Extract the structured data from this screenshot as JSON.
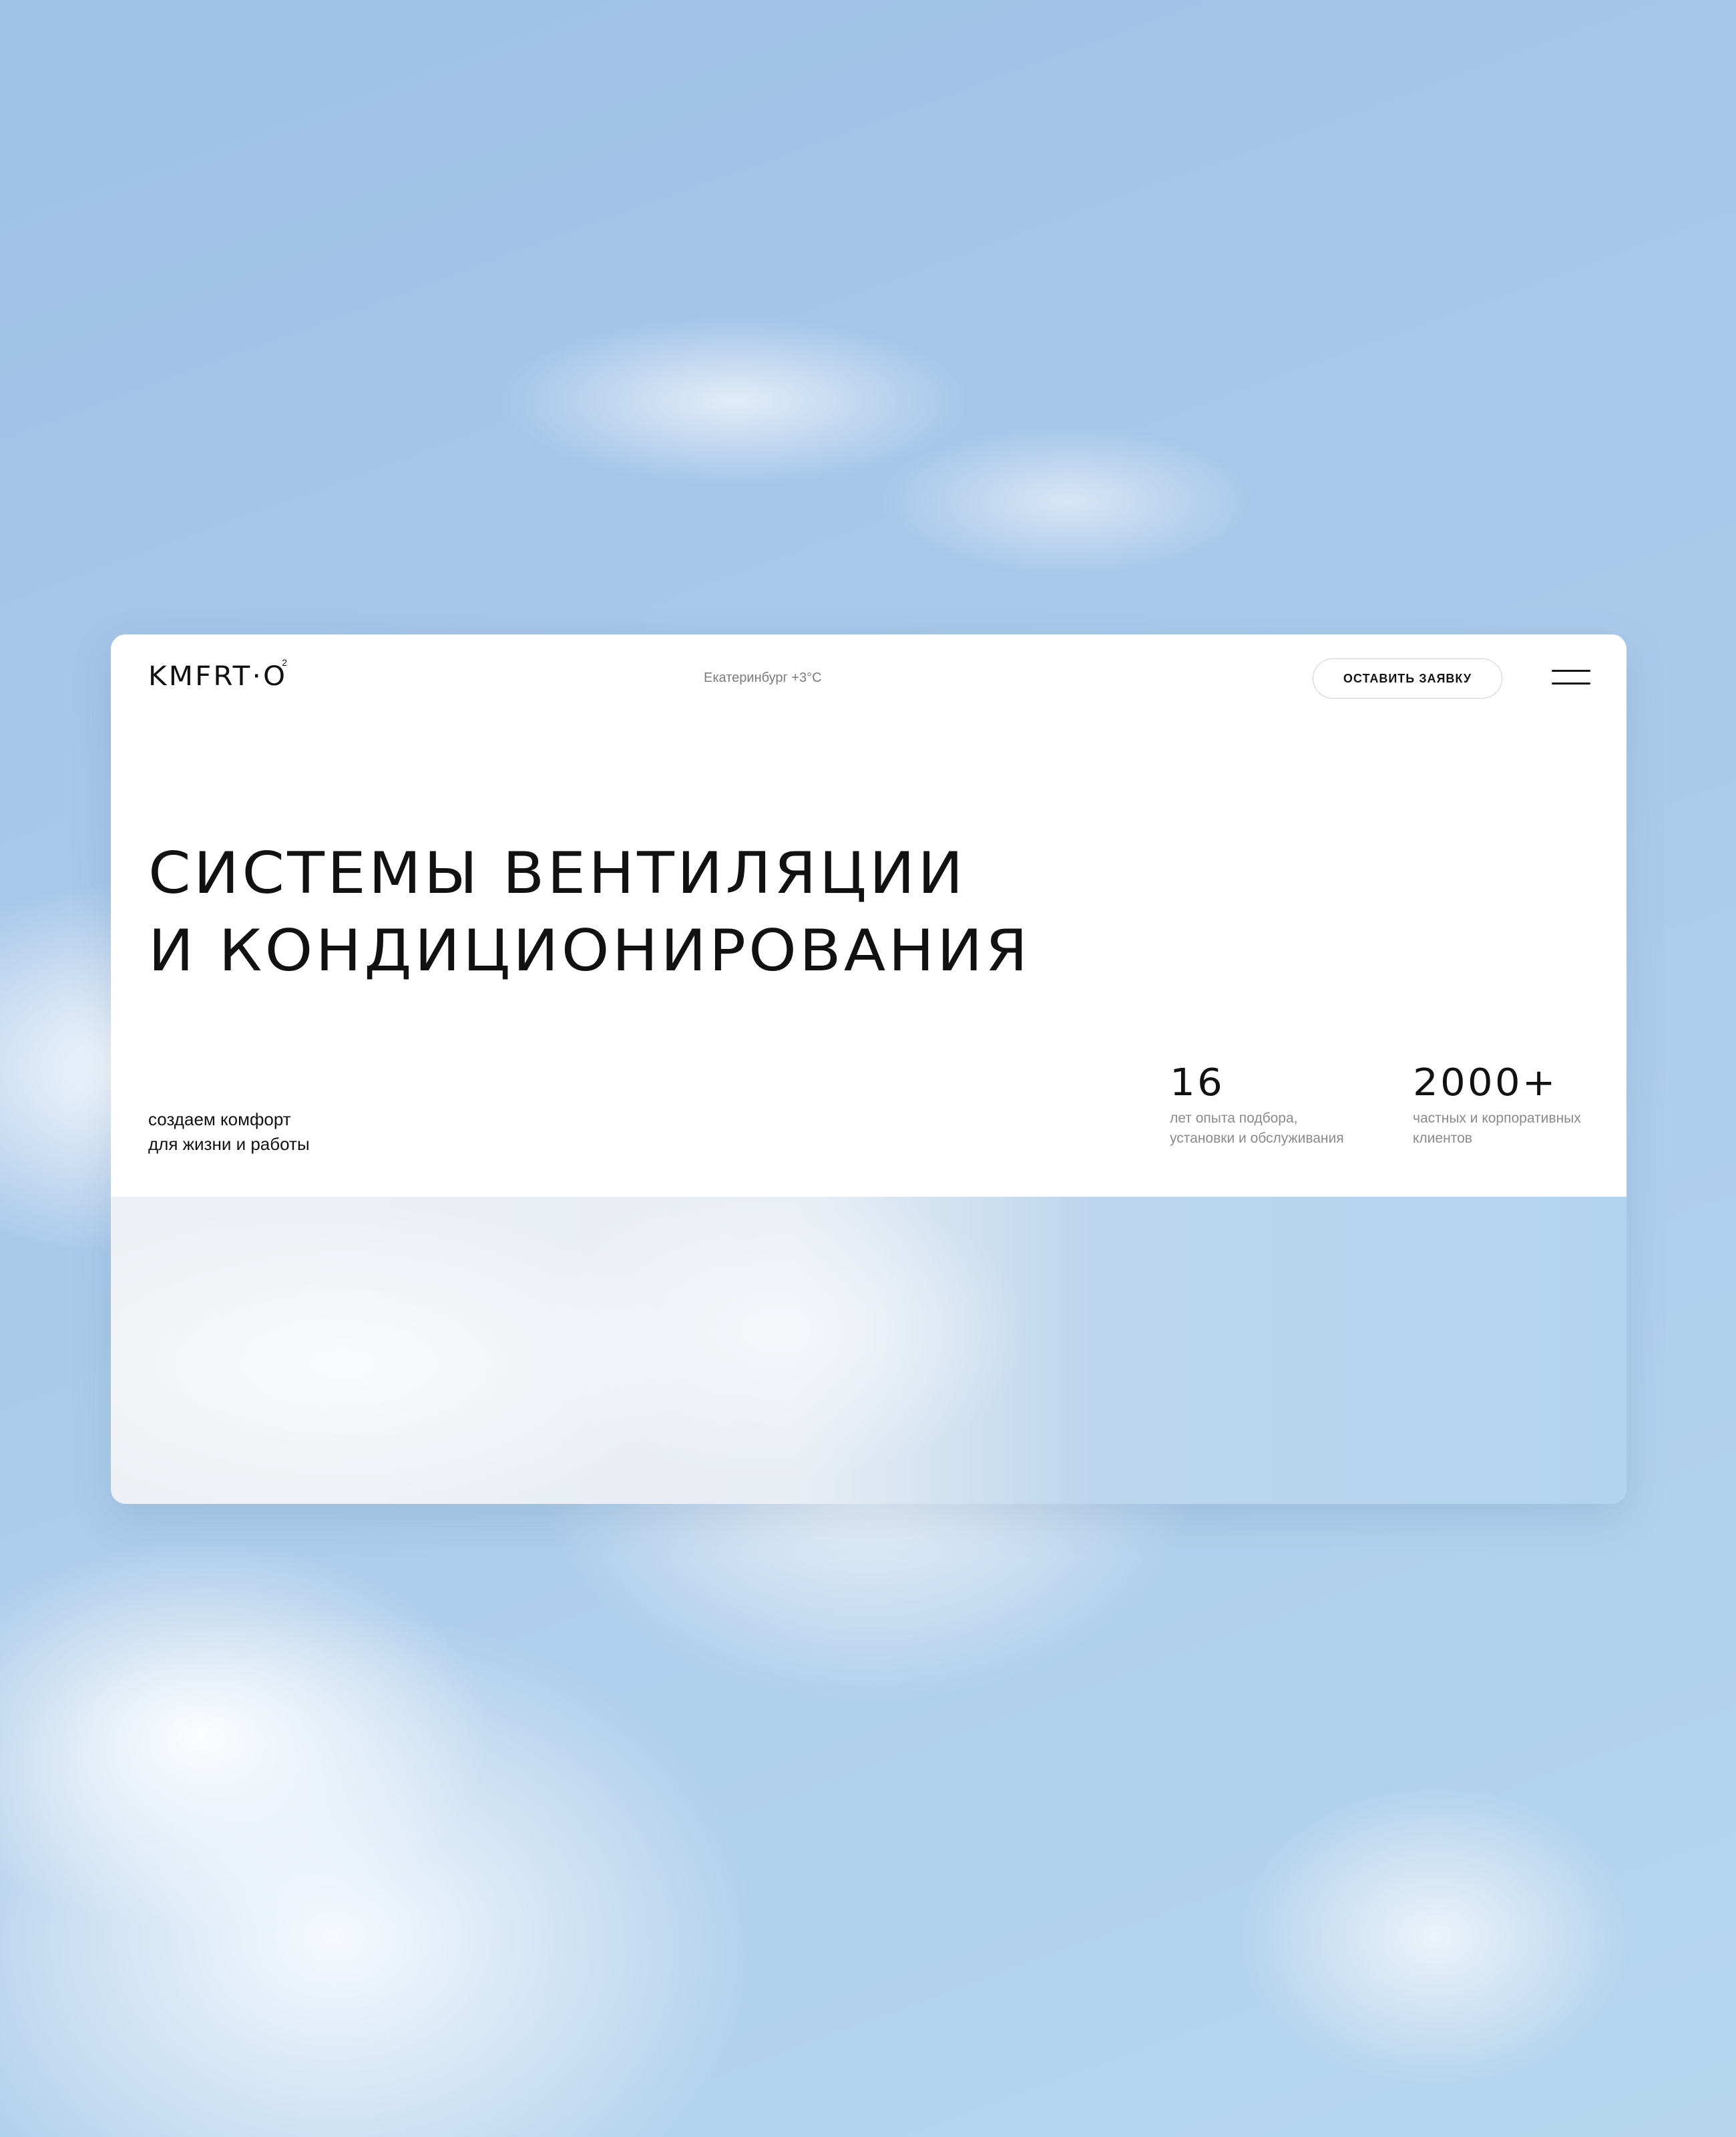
{
  "header": {
    "logo_text": "KMFRT·O",
    "logo_sup": "2",
    "city_weather": "Екатеринбург +3°С",
    "cta_label": "ОСТАВИТЬ ЗАЯВКУ",
    "menu_icon": "hamburger-icon"
  },
  "hero": {
    "headline_line1": "СИСТЕМЫ ВЕНТИЛЯЦИИ",
    "headline_line2": "И КОНДИЦИОНИРОВАНИЯ",
    "tagline_line1": "создаем комфорт",
    "tagline_line2": "для жизни и работы"
  },
  "stats": [
    {
      "number": "16",
      "desc_line1": "лет опыта подбора,",
      "desc_line2": "установки и обслуживания"
    },
    {
      "number": "2000+",
      "desc_line1": "частных и корпоративных",
      "desc_line2": "клиентов"
    }
  ]
}
